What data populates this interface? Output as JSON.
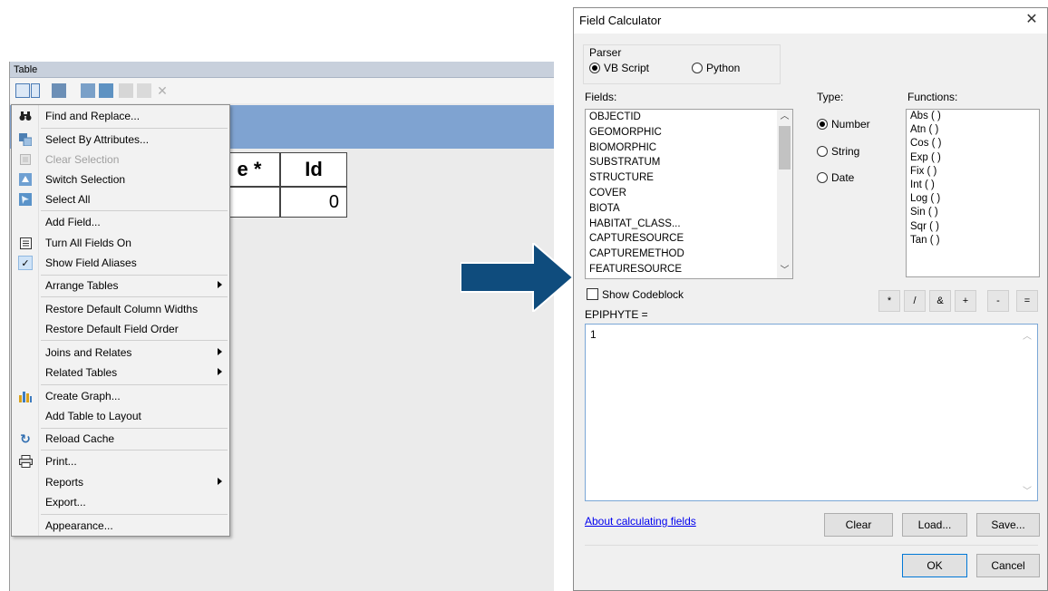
{
  "table_window": {
    "title": "Table",
    "columns": [
      {
        "header": "e *"
      },
      {
        "header": "Id"
      }
    ],
    "row_values": [
      "",
      "0"
    ]
  },
  "context_menu": {
    "items": [
      {
        "label": "Find and Replace...",
        "icon": "binoculars-icon"
      },
      {
        "label": "Select By Attributes...",
        "icon": "select-by-attributes-icon"
      },
      {
        "label": "Clear Selection",
        "icon": "clear-selection-icon",
        "disabled": true
      },
      {
        "label": "Switch Selection",
        "icon": "switch-selection-icon"
      },
      {
        "label": "Select All",
        "icon": "select-all-icon"
      },
      {
        "label": "Add Field...",
        "icon": ""
      },
      {
        "label": "Turn All Fields On",
        "icon": "fields-icon"
      },
      {
        "label": "Show Field Aliases",
        "icon": "check-icon",
        "checked": true
      },
      {
        "label": "Arrange Tables",
        "submenu": true
      },
      {
        "label": "Restore Default Column Widths"
      },
      {
        "label": "Restore Default Field Order"
      },
      {
        "label": "Joins and Relates",
        "submenu": true
      },
      {
        "label": "Related Tables",
        "submenu": true
      },
      {
        "label": "Create Graph...",
        "icon": "bar-chart-icon"
      },
      {
        "label": "Add Table to Layout"
      },
      {
        "label": "Reload Cache",
        "icon": "refresh-icon"
      },
      {
        "label": "Print...",
        "icon": "printer-icon"
      },
      {
        "label": "Reports",
        "submenu": true
      },
      {
        "label": "Export..."
      },
      {
        "label": "Appearance..."
      }
    ]
  },
  "dialog": {
    "title": "Field Calculator",
    "close_glyph": "✕",
    "parser": {
      "label": "Parser",
      "options": [
        "VB Script",
        "Python"
      ],
      "selected": "VB Script"
    },
    "fields_label": "Fields:",
    "fields": [
      "OBJECTID",
      "GEOMORPHIC",
      "BIOMORPHIC",
      "SUBSTRATUM",
      "STRUCTURE",
      "COVER",
      "BIOTA",
      "HABITAT_CLASS...",
      "CAPTURESOURCE",
      "CAPTUREMETHOD",
      "FEATURESOURCE"
    ],
    "type_label": "Type:",
    "types": [
      "Number",
      "String",
      "Date"
    ],
    "selected_type": "Number",
    "functions_label": "Functions:",
    "functions": [
      "Abs ( )",
      "Atn ( )",
      "Cos ( )",
      "Exp ( )",
      "Fix ( )",
      "Int ( )",
      "Log ( )",
      "Sin ( )",
      "Sqr ( )",
      "Tan ( )"
    ],
    "show_codeblock_label": "Show Codeblock",
    "operators": [
      "*",
      "/",
      "&",
      "+",
      "-",
      "="
    ],
    "expression_label": "EPIPHYTE =",
    "expression_value": "1",
    "help_link": "About calculating fields",
    "buttons": {
      "clear": "Clear",
      "load": "Load...",
      "save": "Save...",
      "ok": "OK",
      "cancel": "Cancel"
    }
  },
  "colors": {
    "arrow": "#0f4c7d",
    "table_header_band": "#7fa3d1",
    "link": "#0000ee"
  }
}
